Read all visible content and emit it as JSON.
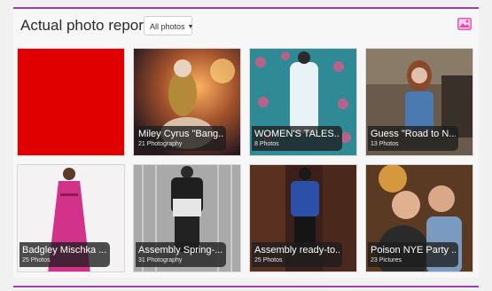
{
  "header": {
    "title": "Actual photo reports",
    "filter_label": "All photos",
    "filter_icon": "chevron-down-icon",
    "gallery_icon": "image-gallery-icon",
    "accent_color": "#9b3fb1",
    "icon_color": "#e24bb0"
  },
  "tiles": [
    {
      "title": "",
      "count": "",
      "color": "#e00000"
    },
    {
      "title": "Miley Cyrus \"Bang...",
      "count": "21 Photography",
      "color": "#6d4a3a"
    },
    {
      "title": "WOMEN'S TALES...",
      "count": "8 Photos",
      "color": "#3b8f9a"
    },
    {
      "title": "Guess \"Road to N...",
      "count": "13 Photos",
      "color": "#5a4a3c"
    },
    {
      "title": "Badgley Mischka ...",
      "count": "25 Photos",
      "color": "#c12a7a"
    },
    {
      "title": "Assembly Spring-...",
      "count": "31 Photography",
      "color": "#8c8c8c"
    },
    {
      "title": "Assembly ready-to...",
      "count": "25 Photos",
      "color": "#4a2a20"
    },
    {
      "title": "Poison NYE Party ...",
      "count": "23 Pictures",
      "color": "#7a5a3a"
    }
  ]
}
